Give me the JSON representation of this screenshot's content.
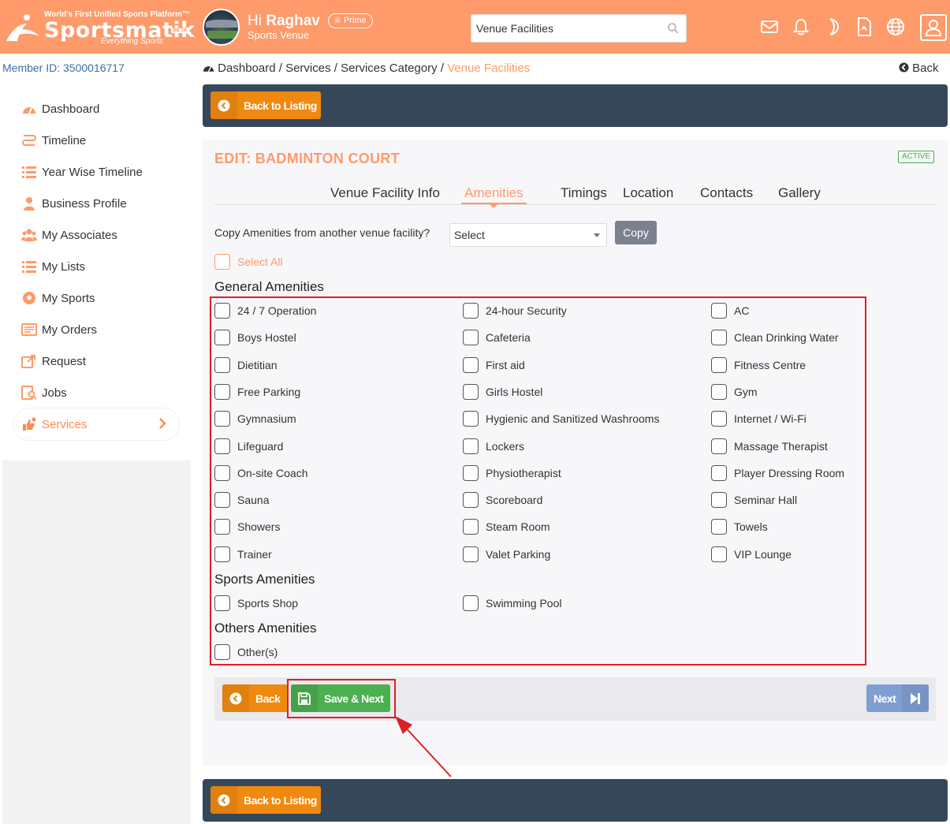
{
  "header": {
    "tagline": "World's First Unified Sports Platform™",
    "brand": "Sportsmatik",
    "beta": "BETA",
    "brand_sub": "Everything Sports",
    "greeting_prefix": "Hi",
    "user_name": "Raghav",
    "prime_label": "Prime",
    "role": "Sports Venue",
    "search_value": "Venue Facilities",
    "icons": [
      "mail-icon",
      "bell-icon",
      "moon-icon",
      "pdf-icon",
      "globe-icon",
      "user-icon"
    ]
  },
  "sidebar": {
    "member_id": "Member ID: 3500016717",
    "items": [
      {
        "label": "Dashboard",
        "icon": "dashboard-icon"
      },
      {
        "label": "Timeline",
        "icon": "timeline-icon"
      },
      {
        "label": "Year Wise Timeline",
        "icon": "list-icon"
      },
      {
        "label": "Business Profile",
        "icon": "person-icon"
      },
      {
        "label": "My Associates",
        "icon": "group-icon"
      },
      {
        "label": "My Lists",
        "icon": "list-icon"
      },
      {
        "label": "My Sports",
        "icon": "ball-icon"
      },
      {
        "label": "My Orders",
        "icon": "orders-icon"
      },
      {
        "label": "Request",
        "icon": "request-icon"
      },
      {
        "label": "Jobs",
        "icon": "jobs-icon"
      },
      {
        "label": "Services",
        "icon": "services-icon",
        "active": true
      }
    ]
  },
  "breadcrumb": {
    "items": [
      "Dashboard",
      "Services",
      "Services Category"
    ],
    "current": "Venue Facilities",
    "separator": "/",
    "back_label": "Back"
  },
  "toolbar": {
    "back_to_listing": "Back to Listing"
  },
  "card": {
    "title": "EDIT: BADMINTON COURT",
    "status": "ACTIVE",
    "tabs": [
      "Venue Facility Info",
      "Amenities",
      "Timings",
      "Location",
      "Contacts",
      "Gallery"
    ],
    "active_tab": "Amenities",
    "copy_label": "Copy Amenities from another venue facility?",
    "copy_select_value": "Select",
    "copy_button": "Copy",
    "select_all": "Select All",
    "sections": {
      "general": {
        "title": "General Amenities",
        "items": [
          "24 / 7 Operation",
          "24-hour Security",
          "AC",
          "Boys Hostel",
          "Cafeteria",
          "Clean Drinking Water",
          "Dietitian",
          "First aid",
          "Fitness Centre",
          "Free Parking",
          "Girls Hostel",
          "Gym",
          "Gymnasium",
          "Hygienic and Sanitized Washrooms",
          "Internet / Wi-Fi",
          "Lifeguard",
          "Lockers",
          "Massage Therapist",
          "On-site Coach",
          "Physiotherapist",
          "Player Dressing Room",
          "Sauna",
          "Scoreboard",
          "Seminar Hall",
          "Showers",
          "Steam Room",
          "Towels",
          "Trainer",
          "Valet Parking",
          "VIP Lounge"
        ]
      },
      "sports": {
        "title": "Sports Amenities",
        "items": [
          "Sports Shop",
          "Swimming Pool"
        ]
      },
      "others": {
        "title": "Others Amenities",
        "items": [
          "Other(s)"
        ]
      }
    },
    "actions": {
      "back": "Back",
      "save_next": "Save & Next",
      "next": "Next"
    }
  },
  "colors": {
    "header_bg": "#ff9a6a",
    "accent": "#ff9a6a",
    "dark_bar": "#37475a",
    "orange_button": "#f0890f",
    "save_button": "#4caf50",
    "next_button": "#7f9fd1",
    "annotation_red": "#e01f26"
  }
}
